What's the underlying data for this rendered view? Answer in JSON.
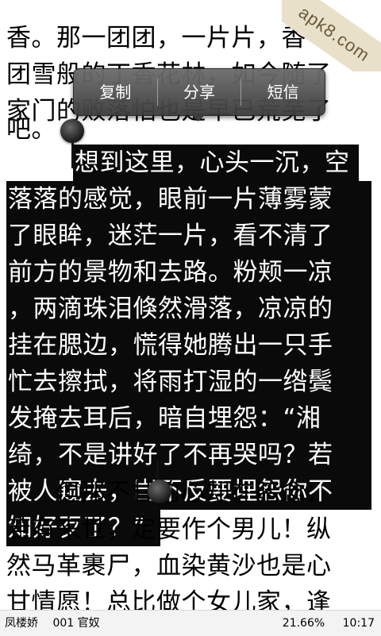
{
  "watermark": {
    "text": "apk8.com"
  },
  "reader": {
    "lines_top": [
      "香。那一团团，一片片，香",
      "团雪般的丁香花林，如今随了",
      "家门的败落怕也是早已荒芜了",
      "吧。"
    ],
    "selected_lines": [
      "想到这里，心头一沉，空",
      "落落的感觉，眼前一片薄雾蒙",
      "了眼眸，迷茫一片，看不清了",
      "前方的景物和去路。粉颊一凉",
      "，两滴珠泪倏然滑落，凉凉的",
      "挂在腮边，慌得她腾出一只手",
      "忙去擦拭，将雨打湿的一绺鬓",
      "发掩去耳后，暗自埋怨：“湘",
      "绮，不是讲好了不再哭吗？若",
      "被人窥去，岂不反要埋怨你不",
      "知好歹了？”"
    ],
    "lines_bottom": [
      "但那不甘的心却在暗念：",
      "若有来世，定要作个男儿！纵",
      "然马革裹尸，血染黄沙也是心",
      "甘情愿！总比做个女儿家，逢"
    ]
  },
  "popup": {
    "copy": "复制",
    "share": "分享",
    "sms": "短信"
  },
  "status": {
    "book_title": "凤楼娇",
    "chapter": "001 官奴",
    "progress": "21.66%",
    "time": "10:17"
  }
}
